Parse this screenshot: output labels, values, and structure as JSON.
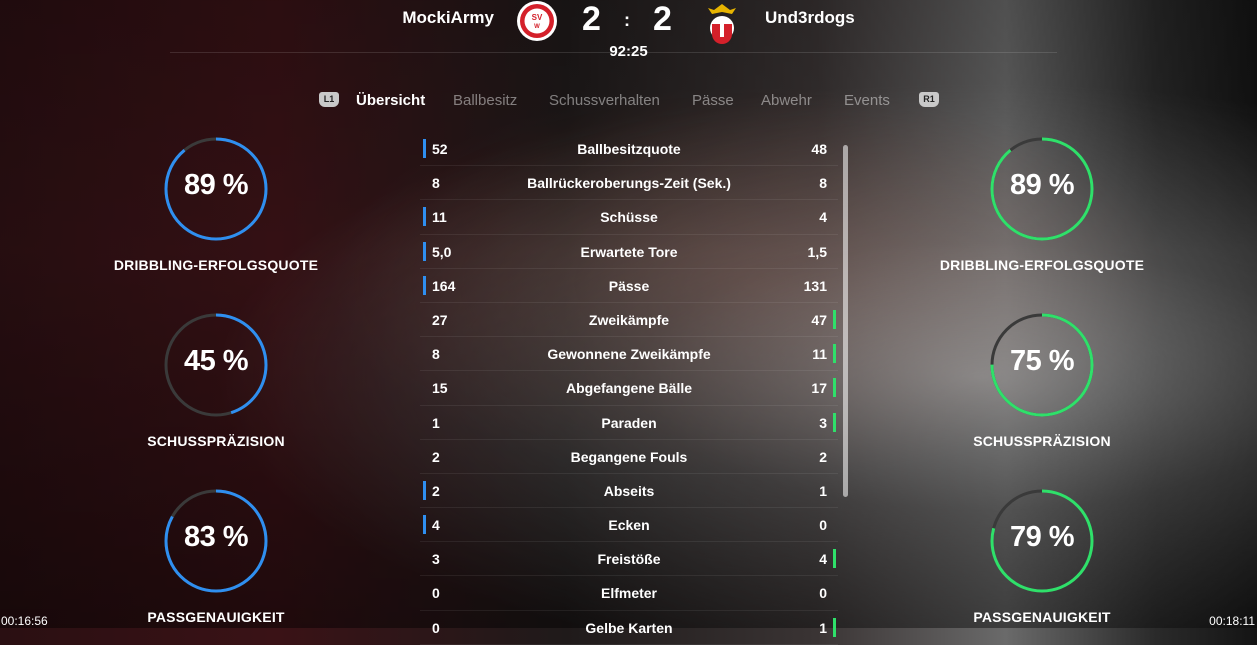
{
  "match": {
    "home_team": "MockiArmy",
    "away_team": "Und3rdogs",
    "home_goals": "2",
    "separator": ":",
    "away_goals": "2",
    "clock": "92:25",
    "home_crest_icon": "sv-wehen-wiesbaden-crest-icon",
    "away_crest_icon": "eagle-crest-icon"
  },
  "tabs": {
    "left_bumper": "L1",
    "right_bumper": "R1",
    "items": [
      {
        "label": "Übersicht",
        "active": true
      },
      {
        "label": "Ballbesitz",
        "active": false
      },
      {
        "label": "Schussverhalten",
        "active": false
      },
      {
        "label": "Pässe",
        "active": false
      },
      {
        "label": "Abwehr",
        "active": false
      },
      {
        "label": "Events",
        "active": false
      }
    ]
  },
  "home_gauges": [
    {
      "value": "89 %",
      "percent": 89,
      "label": "DRIBBLING-ERFOLGSQUOTE"
    },
    {
      "value": "45 %",
      "percent": 45,
      "label": "SCHUSSPRÄZISION"
    },
    {
      "value": "83 %",
      "percent": 83,
      "label": "PASSGENAUIGKEIT"
    }
  ],
  "away_gauges": [
    {
      "value": "89 %",
      "percent": 89,
      "label": "DRIBBLING-ERFOLGSQUOTE"
    },
    {
      "value": "75 %",
      "percent": 75,
      "label": "SCHUSSPRÄZISION"
    },
    {
      "value": "79 %",
      "percent": 79,
      "label": "PASSGENAUIGKEIT"
    }
  ],
  "stats": [
    {
      "home": "52",
      "name": "Ballbesitzquote",
      "away": "48",
      "leader": "home"
    },
    {
      "home": "8",
      "name": "Ballrückeroberungs-Zeit (Sek.)",
      "away": "8",
      "leader": "none"
    },
    {
      "home": "11",
      "name": "Schüsse",
      "away": "4",
      "leader": "home"
    },
    {
      "home": "5,0",
      "name": "Erwartete Tore",
      "away": "1,5",
      "leader": "home"
    },
    {
      "home": "164",
      "name": "Pässe",
      "away": "131",
      "leader": "home"
    },
    {
      "home": "27",
      "name": "Zweikämpfe",
      "away": "47",
      "leader": "away"
    },
    {
      "home": "8",
      "name": "Gewonnene Zweikämpfe",
      "away": "11",
      "leader": "away"
    },
    {
      "home": "15",
      "name": "Abgefangene Bälle",
      "away": "17",
      "leader": "away"
    },
    {
      "home": "1",
      "name": "Paraden",
      "away": "3",
      "leader": "away"
    },
    {
      "home": "2",
      "name": "Begangene Fouls",
      "away": "2",
      "leader": "none"
    },
    {
      "home": "2",
      "name": "Abseits",
      "away": "1",
      "leader": "home"
    },
    {
      "home": "4",
      "name": "Ecken",
      "away": "0",
      "leader": "home"
    },
    {
      "home": "3",
      "name": "Freistöße",
      "away": "4",
      "leader": "away"
    },
    {
      "home": "0",
      "name": "Elfmeter",
      "away": "0",
      "leader": "none"
    },
    {
      "home": "0",
      "name": "Gelbe Karten",
      "away": "1",
      "leader": "away"
    }
  ],
  "video": {
    "elapsed": "00:16:56",
    "duration": "00:18:11"
  },
  "colors": {
    "home_accent": "#2f8ff0",
    "away_accent": "#2fe06a",
    "gauge_track": "#3a3a3a"
  }
}
